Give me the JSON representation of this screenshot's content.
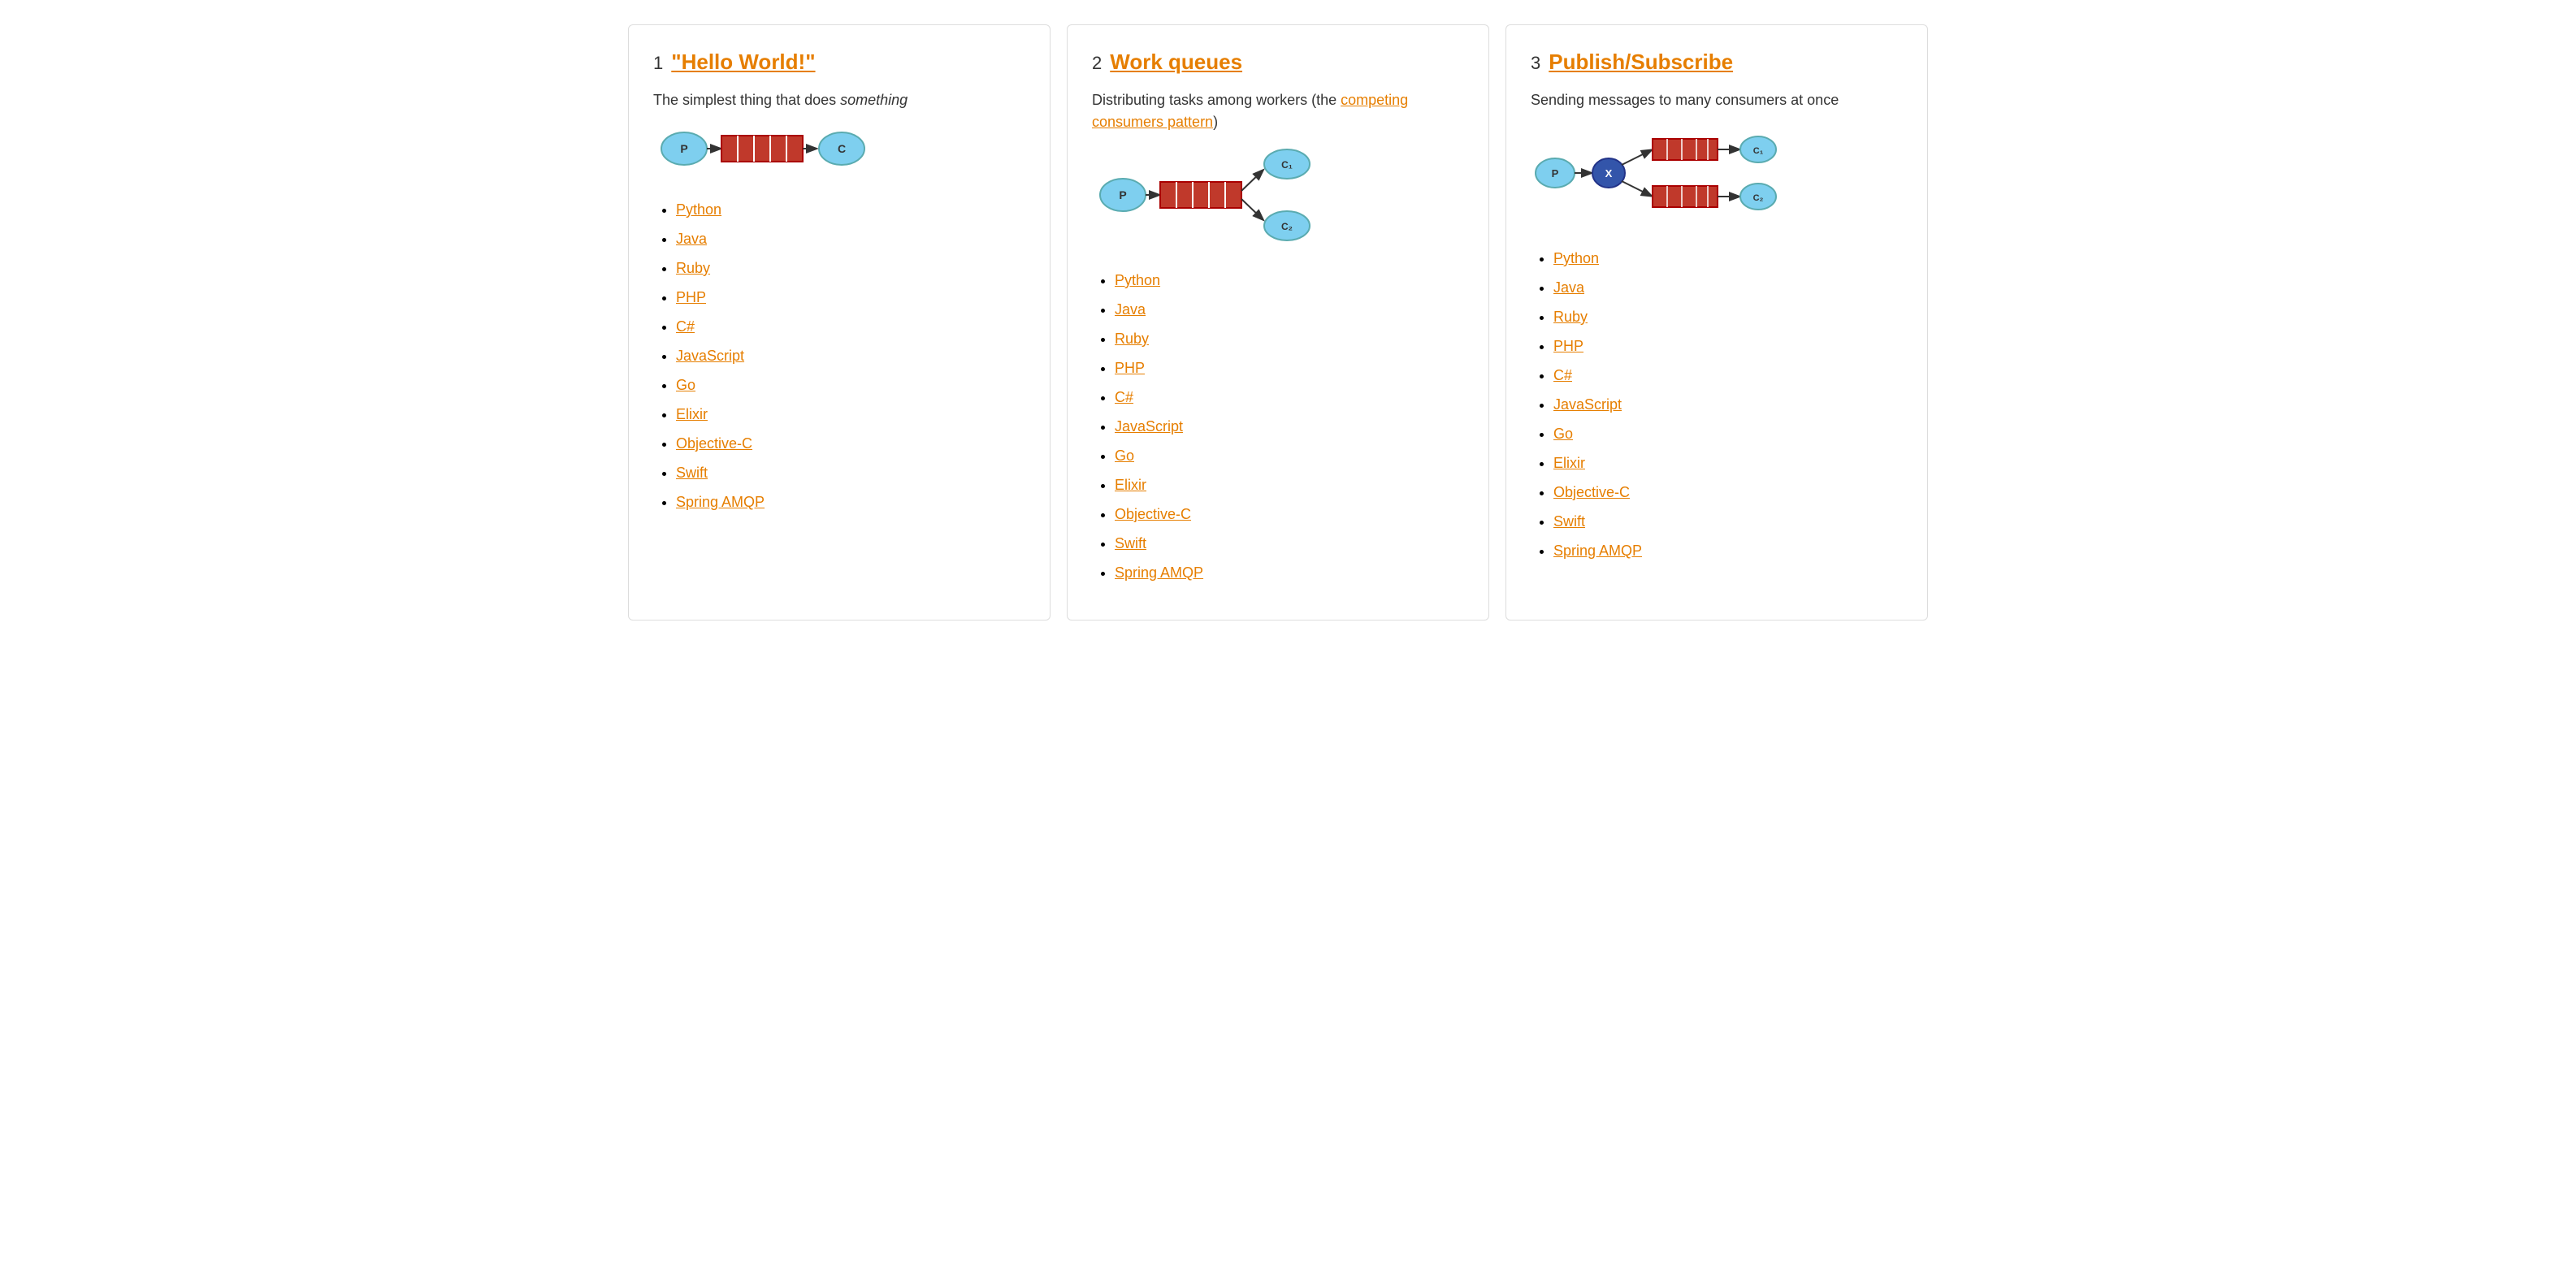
{
  "cards": [
    {
      "number": "1",
      "title": "\"Hello World!\"",
      "titleHref": "#",
      "description": "The simplest thing that does <em>something</em>",
      "diagram": "hello-world",
      "links": [
        {
          "label": "Python",
          "href": "#"
        },
        {
          "label": "Java",
          "href": "#"
        },
        {
          "label": "Ruby",
          "href": "#"
        },
        {
          "label": "PHP",
          "href": "#"
        },
        {
          "label": "C#",
          "href": "#"
        },
        {
          "label": "JavaScript",
          "href": "#"
        },
        {
          "label": "Go",
          "href": "#"
        },
        {
          "label": "Elixir",
          "href": "#"
        },
        {
          "label": "Objective-C",
          "href": "#"
        },
        {
          "label": "Swift",
          "href": "#"
        },
        {
          "label": "Spring AMQP",
          "href": "#"
        }
      ]
    },
    {
      "number": "2",
      "title": "Work queues",
      "titleHref": "#",
      "description": "Distributing tasks among workers (the <a href=\"#\">competing consumers pattern</a>)",
      "diagram": "work-queues",
      "links": [
        {
          "label": "Python",
          "href": "#"
        },
        {
          "label": "Java",
          "href": "#"
        },
        {
          "label": "Ruby",
          "href": "#"
        },
        {
          "label": "PHP",
          "href": "#"
        },
        {
          "label": "C#",
          "href": "#"
        },
        {
          "label": "JavaScript",
          "href": "#"
        },
        {
          "label": "Go",
          "href": "#"
        },
        {
          "label": "Elixir",
          "href": "#"
        },
        {
          "label": "Objective-C",
          "href": "#"
        },
        {
          "label": "Swift",
          "href": "#"
        },
        {
          "label": "Spring AMQP",
          "href": "#"
        }
      ]
    },
    {
      "number": "3",
      "title": "Publish/Subscribe",
      "titleHref": "#",
      "description": "Sending messages to many consumers at once",
      "diagram": "pubsub",
      "links": [
        {
          "label": "Python",
          "href": "#"
        },
        {
          "label": "Java",
          "href": "#"
        },
        {
          "label": "Ruby",
          "href": "#"
        },
        {
          "label": "PHP",
          "href": "#"
        },
        {
          "label": "C#",
          "href": "#"
        },
        {
          "label": "JavaScript",
          "href": "#"
        },
        {
          "label": "Go",
          "href": "#"
        },
        {
          "label": "Elixir",
          "href": "#"
        },
        {
          "label": "Objective-C",
          "href": "#"
        },
        {
          "label": "Swift",
          "href": "#"
        },
        {
          "label": "Spring AMQP",
          "href": "#"
        }
      ]
    }
  ]
}
